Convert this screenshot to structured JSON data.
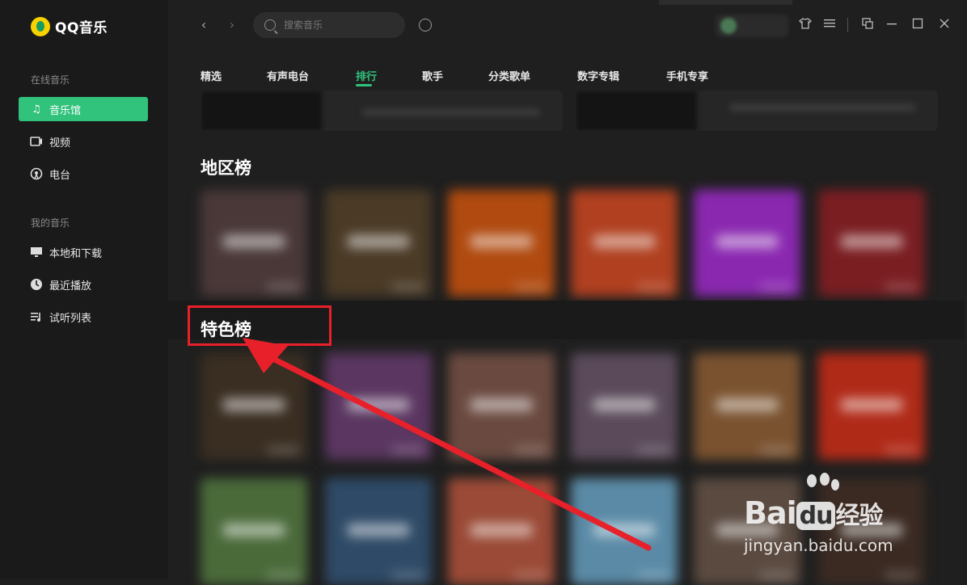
{
  "app": {
    "name": "QQ音乐"
  },
  "sidebar": {
    "section1_title": "在线音乐",
    "items1": [
      {
        "label": "音乐馆",
        "icon": "music-note-icon",
        "active": true
      },
      {
        "label": "视频",
        "icon": "video-icon",
        "active": false
      },
      {
        "label": "电台",
        "icon": "radio-icon",
        "active": false
      }
    ],
    "section2_title": "我的音乐",
    "items2": [
      {
        "label": "本地和下载",
        "icon": "monitor-icon"
      },
      {
        "label": "最近播放",
        "icon": "clock-icon"
      },
      {
        "label": "试听列表",
        "icon": "playlist-icon"
      }
    ]
  },
  "search": {
    "placeholder": "搜索音乐"
  },
  "tabs": [
    "精选",
    "有声电台",
    "排行",
    "歌手",
    "分类歌单",
    "数字专辑",
    "手机专享"
  ],
  "active_tab": "排行",
  "sections": {
    "region": "地区榜",
    "featured": "特色榜"
  },
  "colors": {
    "accent": "#31c27c",
    "annotation": "#e8202a"
  },
  "watermark": {
    "brand_a": "Bai",
    "brand_b": "du",
    "brand_c": "经验",
    "url": "jingyan.baidu.com"
  }
}
